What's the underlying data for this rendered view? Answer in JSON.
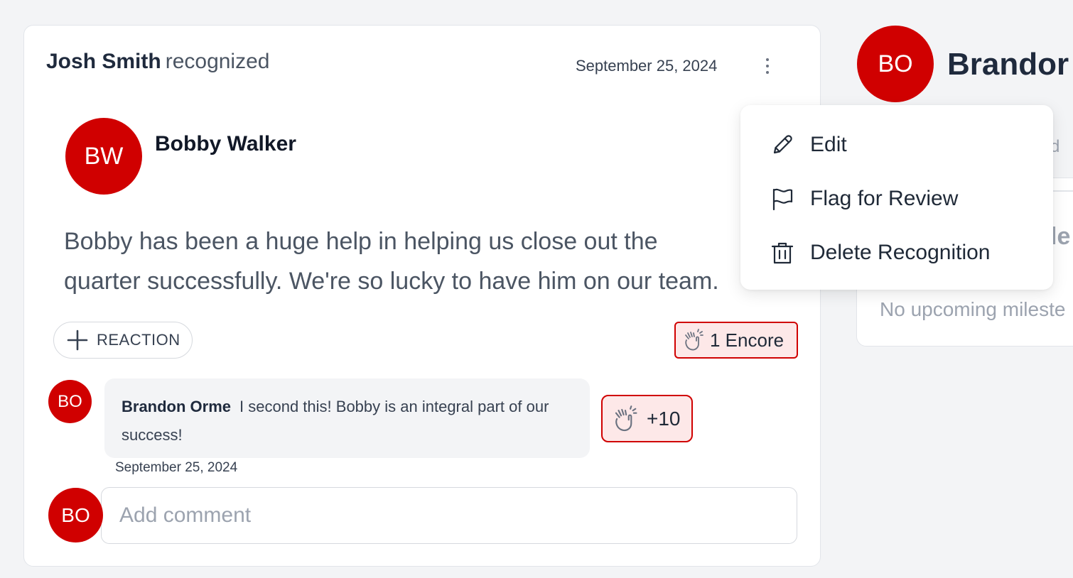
{
  "recognition": {
    "recognizer": "Josh Smith",
    "action": "recognized",
    "date": "September 25, 2024",
    "recipient_initials": "BW",
    "recipient_name": "Bobby Walker",
    "message_line1": "Bobby has been a huge help in helping us close out the",
    "message_line2": "quarter successfully. We're so lucky to have him on our team.",
    "reaction_button_label": "REACTION",
    "encore_label": "1 Encore"
  },
  "comment": {
    "author_initials": "BO",
    "author": "Brandon Orme",
    "text": "I second this! Bobby is an integral part of our success!",
    "clap_count": "+10",
    "date": "September 25, 2024"
  },
  "comment_input": {
    "user_initials": "BO",
    "placeholder": "Add comment"
  },
  "menu": {
    "items": [
      {
        "label": "Edit",
        "icon": "pencil-icon"
      },
      {
        "label": "Flag for Review",
        "icon": "flag-icon"
      },
      {
        "label": "Delete Recognition",
        "icon": "trash-icon"
      }
    ]
  },
  "profile_panel": {
    "initials": "BO",
    "name_visible": "Brandor",
    "peek_d": "d",
    "peek_le": "le",
    "no_milestones_visible": "No upcoming mileste"
  },
  "colors": {
    "avatar": "#d00000",
    "badge_bg": "#fde8e8",
    "badge_border": "#d00000",
    "page_bg": "#f3f4f6"
  }
}
